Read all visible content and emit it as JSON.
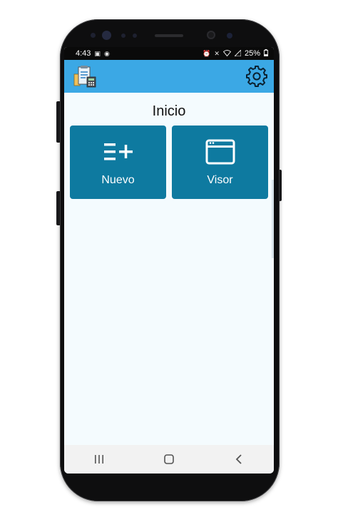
{
  "status_bar": {
    "time": "4:43",
    "left_icons": [
      "image-icon",
      "messenger-icon"
    ],
    "right_icons": [
      "alarm-icon",
      "mute-icon",
      "wifi-icon",
      "signal-icon"
    ],
    "battery": "25%"
  },
  "app_bar": {
    "logo": "app-logo",
    "settings_icon": "gear-icon"
  },
  "page": {
    "title": "Inicio"
  },
  "tiles": [
    {
      "label": "Nuevo",
      "icon": "list-add-icon"
    },
    {
      "label": "Visor",
      "icon": "browser-window-icon"
    }
  ],
  "colors": {
    "app_bar": "#3ba8e5",
    "tile": "#0e7aa0",
    "background": "#f4fbfe"
  },
  "nav_bar": {
    "buttons": [
      "recents-icon",
      "home-icon",
      "back-icon"
    ]
  }
}
